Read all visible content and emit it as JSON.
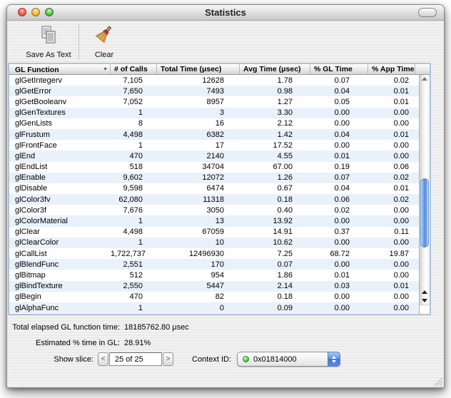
{
  "window": {
    "title": "Statistics"
  },
  "toolbar": {
    "save_as_text_label": "Save As Text",
    "clear_label": "Clear"
  },
  "table": {
    "columns": [
      "GL Function",
      "# of Calls",
      "Total Time (μsec)",
      "Avg Time (μsec)",
      "% GL Time",
      "% App Time"
    ],
    "sort_icon": "▼",
    "rows": [
      {
        "func": "glGetIntegerv",
        "calls": "7,105",
        "total": "12628",
        "avg": "1.78",
        "gl": "0.07",
        "app": "0.02"
      },
      {
        "func": "glGetError",
        "calls": "7,650",
        "total": "7493",
        "avg": "0.98",
        "gl": "0.04",
        "app": "0.01"
      },
      {
        "func": "glGetBooleanv",
        "calls": "7,052",
        "total": "8957",
        "avg": "1.27",
        "gl": "0.05",
        "app": "0.01"
      },
      {
        "func": "glGenTextures",
        "calls": "1",
        "total": "3",
        "avg": "3.30",
        "gl": "0.00",
        "app": "0.00"
      },
      {
        "func": "glGenLists",
        "calls": "8",
        "total": "16",
        "avg": "2.12",
        "gl": "0.00",
        "app": "0.00"
      },
      {
        "func": "glFrustum",
        "calls": "4,498",
        "total": "6382",
        "avg": "1.42",
        "gl": "0.04",
        "app": "0.01"
      },
      {
        "func": "glFrontFace",
        "calls": "1",
        "total": "17",
        "avg": "17.52",
        "gl": "0.00",
        "app": "0.00"
      },
      {
        "func": "glEnd",
        "calls": "470",
        "total": "2140",
        "avg": "4.55",
        "gl": "0.01",
        "app": "0.00"
      },
      {
        "func": "glEndList",
        "calls": "518",
        "total": "34704",
        "avg": "67.00",
        "gl": "0.19",
        "app": "0.06"
      },
      {
        "func": "glEnable",
        "calls": "9,602",
        "total": "12072",
        "avg": "1.26",
        "gl": "0.07",
        "app": "0.02"
      },
      {
        "func": "glDisable",
        "calls": "9,598",
        "total": "6474",
        "avg": "0.67",
        "gl": "0.04",
        "app": "0.01"
      },
      {
        "func": "glColor3fv",
        "calls": "62,080",
        "total": "11318",
        "avg": "0.18",
        "gl": "0.06",
        "app": "0.02"
      },
      {
        "func": "glColor3f",
        "calls": "7,676",
        "total": "3050",
        "avg": "0.40",
        "gl": "0.02",
        "app": "0.00"
      },
      {
        "func": "glColorMaterial",
        "calls": "1",
        "total": "13",
        "avg": "13.92",
        "gl": "0.00",
        "app": "0.00"
      },
      {
        "func": "glClear",
        "calls": "4,498",
        "total": "67059",
        "avg": "14.91",
        "gl": "0.37",
        "app": "0.11"
      },
      {
        "func": "glClearColor",
        "calls": "1",
        "total": "10",
        "avg": "10.62",
        "gl": "0.00",
        "app": "0.00"
      },
      {
        "func": "glCallList",
        "calls": "1,722,737",
        "total": "12496930",
        "avg": "7.25",
        "gl": "68.72",
        "app": "19.87"
      },
      {
        "func": "glBlendFunc",
        "calls": "2,551",
        "total": "170",
        "avg": "0.07",
        "gl": "0.00",
        "app": "0.00"
      },
      {
        "func": "glBitmap",
        "calls": "512",
        "total": "954",
        "avg": "1.86",
        "gl": "0.01",
        "app": "0.00"
      },
      {
        "func": "glBindTexture",
        "calls": "2,550",
        "total": "5447",
        "avg": "2.14",
        "gl": "0.03",
        "app": "0.01"
      },
      {
        "func": "glBegin",
        "calls": "470",
        "total": "82",
        "avg": "0.18",
        "gl": "0.00",
        "app": "0.00"
      },
      {
        "func": "glAlphaFunc",
        "calls": "1",
        "total": "0",
        "avg": "0.09",
        "gl": "0.00",
        "app": "0.00"
      }
    ]
  },
  "footer": {
    "total_label": "Total elapsed GL function time:",
    "total_value": "18185762.80 μsec",
    "estimated_label": "Estimated % time in GL:",
    "estimated_value": "28.91%",
    "show_slice_label": "Show slice:",
    "slice_prev": "<",
    "slice_value": "25 of 25",
    "slice_next": ">",
    "context_label": "Context ID:",
    "context_value": "0x01814000"
  },
  "colors": {
    "alt_row": "#e9f1fb",
    "scroll_thumb_blue": "#4d8ee2",
    "table_border": "#aec3d8",
    "led_green": "#2da32a"
  }
}
